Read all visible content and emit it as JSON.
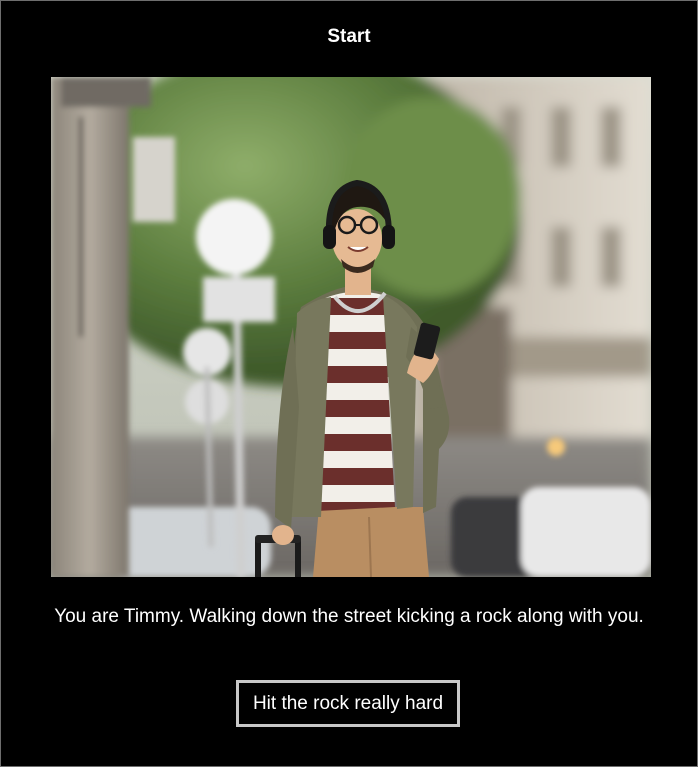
{
  "story": {
    "title": "Start",
    "narration": "You are Timmy. Walking down the street kicking a rock along with you.",
    "choices": [
      {
        "label": "Hit the rock really hard"
      }
    ]
  },
  "colors": {
    "background": "#000000",
    "text": "#ffffff",
    "button_border": "#c8c8c8"
  }
}
